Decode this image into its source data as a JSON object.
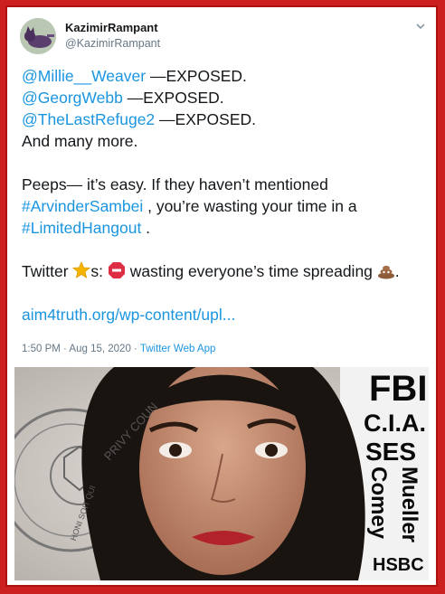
{
  "tweet": {
    "display_name": "KazimirRampant",
    "handle": "@KazimirRampant",
    "mentions": [
      "@Millie__Weaver",
      "@GeorgWebb",
      "@TheLastRefuge2"
    ],
    "exposed_suffix": " —EXPOSED.",
    "more": "And many more.",
    "para2_a": "Peeps— it’s easy. If they haven’t mentioned",
    "hashtag1": "#ArvinderSambei",
    "para2_b": " , you’re wasting your time in a",
    "hashtag2": "#LimitedHangout",
    "para2_c": " .",
    "twitter_word": "Twitter ",
    "s_colon": "s:  ",
    "wasting": " wasting everyone’s time spreading ",
    "dot": ".",
    "link": "aim4truth.org/wp-content/upl...",
    "time": "1:50 PM · Aug 15, 2020",
    "separator": " · ",
    "app": "Twitter Web App"
  },
  "image": {
    "seal_text": "PRIVY COUN",
    "seal_motto": "HONI SOIT QUI",
    "labels": [
      "FBI",
      "C.I.A.",
      "SES",
      "Comey",
      "Mueller",
      "HSBC"
    ]
  },
  "icons": [
    "avatar-cat-icon",
    "chevron-down-icon",
    "star-emoji-icon",
    "stop-sign-emoji-icon",
    "poop-emoji-icon"
  ],
  "colors": {
    "link": "#1b95e0",
    "border": "#cc1f1f",
    "muted": "#657786"
  }
}
